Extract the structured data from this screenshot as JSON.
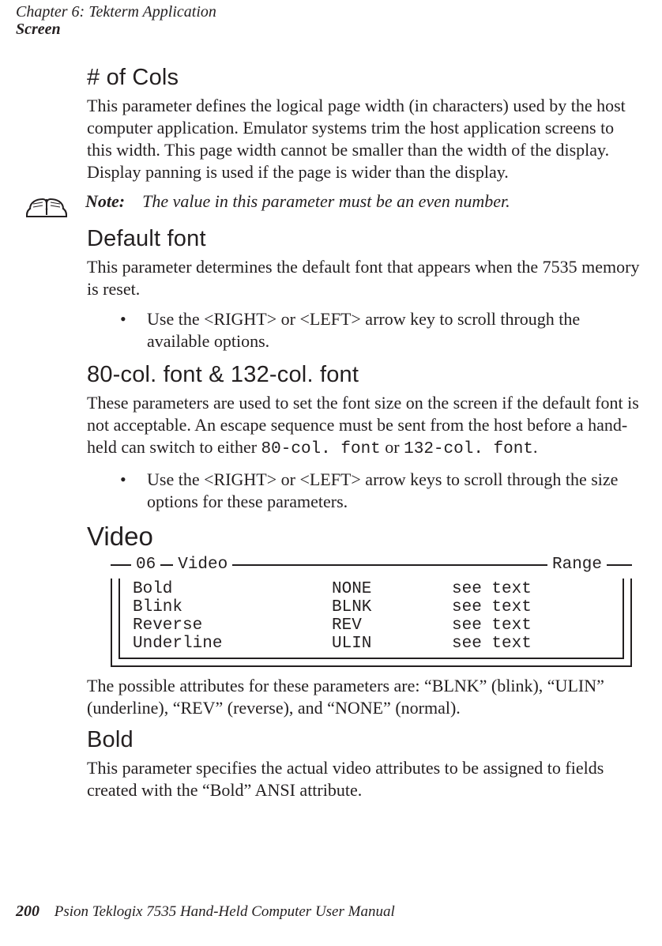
{
  "runhead": {
    "line1": "Chapter 6: Tekterm Application",
    "line2": "Screen"
  },
  "s1": {
    "title": "# of Cols",
    "p": "This parameter defines the logical page width (in characters) used by the host computer application. Emulator systems trim the host application screens to this width. This page width cannot be smaller than the width of the display. Display panning is used if the page is wider than the display."
  },
  "note": {
    "label": "Note:",
    "text": "The value in this parameter must be an even number."
  },
  "s2": {
    "title": "Default font",
    "p": "This parameter determines the default font that appears when the 7535 memory is reset.",
    "bullet": "Use the <RIGHT> or <LEFT> arrow key to scroll through the available options."
  },
  "s3": {
    "title": "80-col. font & 132-col. font",
    "p_pre": "These parameters are used to set the font size on the screen if the default font is not acceptable. An escape sequence must be sent from the host before a hand-held can switch to either ",
    "code1": "80-col. font",
    "p_mid": " or ",
    "code2": "132-col. font",
    "p_post": ".",
    "bullet": "Use the <RIGHT> or <LEFT> arrow keys to scroll through the size options for these parameters."
  },
  "s4": {
    "title": "Video",
    "box": {
      "num": "06",
      "label": "Video",
      "range": "Range",
      "rows": [
        {
          "name": "Bold",
          "val": "NONE",
          "rng": "see text"
        },
        {
          "name": "Blink",
          "val": "BLNK",
          "rng": "see text"
        },
        {
          "name": "Reverse",
          "val": "REV",
          "rng": "see text"
        },
        {
          "name": "Underline",
          "val": "ULIN",
          "rng": "see text"
        }
      ]
    },
    "p_after": "The possible attributes for these parameters are: “BLNK” (blink), “ULIN” (underline), “REV” (reverse), and “NONE” (normal)."
  },
  "s5": {
    "title": "Bold",
    "p": "This parameter specifies the actual video attributes to be assigned to fields created with the “Bold” ANSI attribute."
  },
  "footer": {
    "page": "200",
    "text": "Psion Teklogix 7535 Hand-Held Computer User Manual"
  }
}
